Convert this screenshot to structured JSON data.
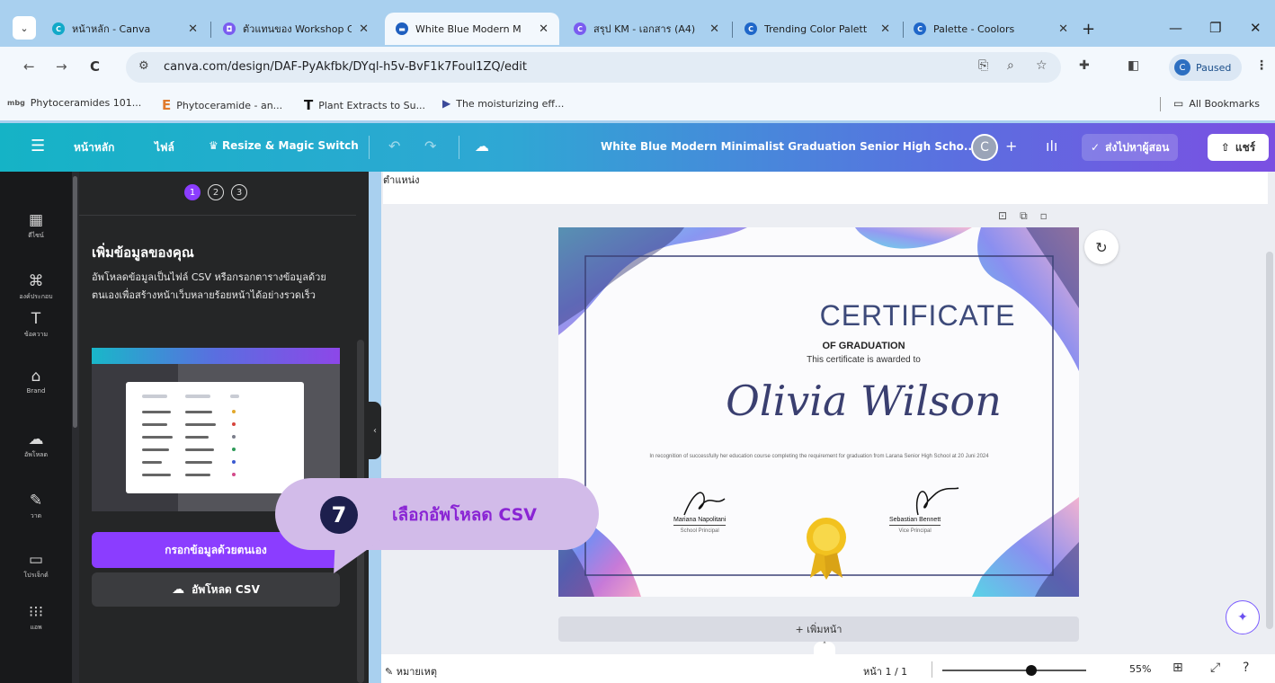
{
  "browser": {
    "tabs": [
      {
        "title": "หน้าหลัก - Canva",
        "fav_color": "#12a9c8",
        "fav_letter": "C"
      },
      {
        "title": "ตัวแทนของ Workshop C",
        "fav_color": "#7a5cf0",
        "fav_letter": "◘"
      },
      {
        "title": "White Blue Modern M",
        "fav_color": "#1f5fbf",
        "fav_letter": "▬",
        "active": true
      },
      {
        "title": "สรุป KM - เอกสาร (A4)",
        "fav_color": "#7a5cf0",
        "fav_letter": "C"
      },
      {
        "title": "Trending Color Palett",
        "fav_color": "#1f67c9",
        "fav_letter": "C"
      },
      {
        "title": "Palette - Coolors",
        "fav_color": "#1f67c9",
        "fav_letter": "C"
      }
    ],
    "url": "canva.com/design/DAF-PyAkfbk/DYql-h5v-BvF1k7Foul1ZQ/edit",
    "paused_label": "Paused",
    "paused_avatar": "C",
    "bookmarks": [
      {
        "icon": "mbg",
        "label": "Phytoceramides 101..."
      },
      {
        "icon": "E",
        "label": "Phytoceramide - an..."
      },
      {
        "icon": "T",
        "label": "Plant Extracts to Su..."
      },
      {
        "icon": "▶",
        "label": "The moisturizing eff..."
      }
    ],
    "all_bookmarks": "All Bookmarks"
  },
  "canva": {
    "home": "หน้าหลัก",
    "file": "ไฟล์",
    "resize": "Resize & Magic Switch",
    "doc_title": "White Blue Modern Minimalist Graduation Senior High Scho...",
    "avatar": "C",
    "present": "ส่งไปหาผู้สอน",
    "share": "แชร์"
  },
  "rail": [
    {
      "icon": "▦",
      "label": "ดีไซน์"
    },
    {
      "icon": "⌘",
      "label": "องค์ประกอบ"
    },
    {
      "icon": "T",
      "label": "ข้อความ"
    },
    {
      "icon": "⌂",
      "label": "Brand"
    },
    {
      "icon": "☁",
      "label": "อัพโหลด"
    },
    {
      "icon": "✎",
      "label": "วาด"
    },
    {
      "icon": "▭",
      "label": "โปรเจ็กต์"
    },
    {
      "icon": "⁝⁝⁝",
      "label": "แอพ"
    }
  ],
  "panel": {
    "steps": [
      "1",
      "2",
      "3"
    ],
    "heading": "เพิ่มข้อมูลของคุณ",
    "description": "อัพโหลดข้อมูลเป็นไฟล์ CSV หรือกรอกตารางข้อมูลด้วยตนเองเพื่อสร้างหน้าเว็บหลายร้อยหน้าได้อย่างรวดเร็ว",
    "manual_button": "กรอกข้อมูลด้วยตนเอง",
    "csv_button": "อัพโหลด CSV"
  },
  "callout": {
    "number": "7",
    "text": "เลือกอัพโหลด CSV"
  },
  "canvas": {
    "position_label": "ตำแหน่ง",
    "add_page": "+ เพิ่มหน้า",
    "certificate": {
      "title": "CERTIFICATE",
      "subtitle": "OF GRADUATION",
      "awarded": "This certificate is awarded to",
      "name": "Olivia Wilson",
      "recognition": "In recognition of successfully her education course completing the requirement for graduation from Larana Senior High School at 20 Juni 2024",
      "signer1_name": "Mariana Napolitani",
      "signer1_role": "School Principal",
      "signer2_name": "Sebastian Bennett",
      "signer2_role": "Vice Principal"
    }
  },
  "status": {
    "notes": "หมายเหตุ",
    "pager": "หน้า 1 / 1",
    "zoom": "55%",
    "zoom_fraction": 0.55
  },
  "colors": {
    "accent": "#8b3dff",
    "callout_bg": "#d2bbe9",
    "callout_text": "#8a25d4"
  }
}
